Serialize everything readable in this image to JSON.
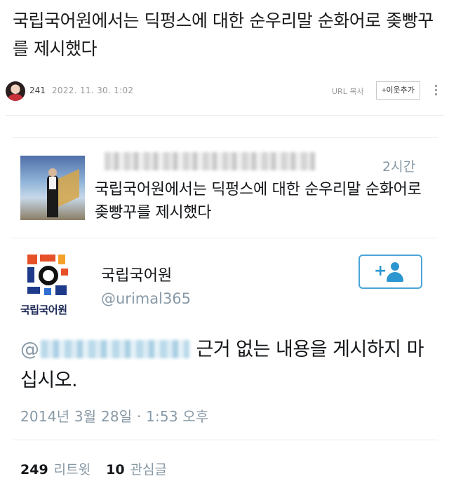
{
  "post": {
    "title": "국립국어원에서는 딕펑스에 대한 순우리말 순화어로 좆빵꾸를 제시했다",
    "author": "241",
    "date": "2022. 11. 30. 1:02",
    "url_copy_label": "URL 복사",
    "add_neighbor_label": "+이웃추가"
  },
  "quote": {
    "time": "2시간",
    "text": "국립국어원에서는 딕펑스에 대한 순우리말 순화어로 좆빵꾸를 제시했다"
  },
  "tweet": {
    "org_name": "국립국어원",
    "handle": "@urimal365",
    "logo_caption": "국립국어원",
    "at_sign": "@",
    "reply_text": "근거 없는 내용을 게시하지 마십시오.",
    "date": "2014년 3월 28일 · 1:53 오후",
    "retweets_count": "249",
    "retweets_label": "리트윗",
    "likes_count": "10",
    "likes_label": "관심글"
  },
  "colors": {
    "accent": "#2b96cf",
    "muted": "#8899a6",
    "text": "#14171a"
  }
}
